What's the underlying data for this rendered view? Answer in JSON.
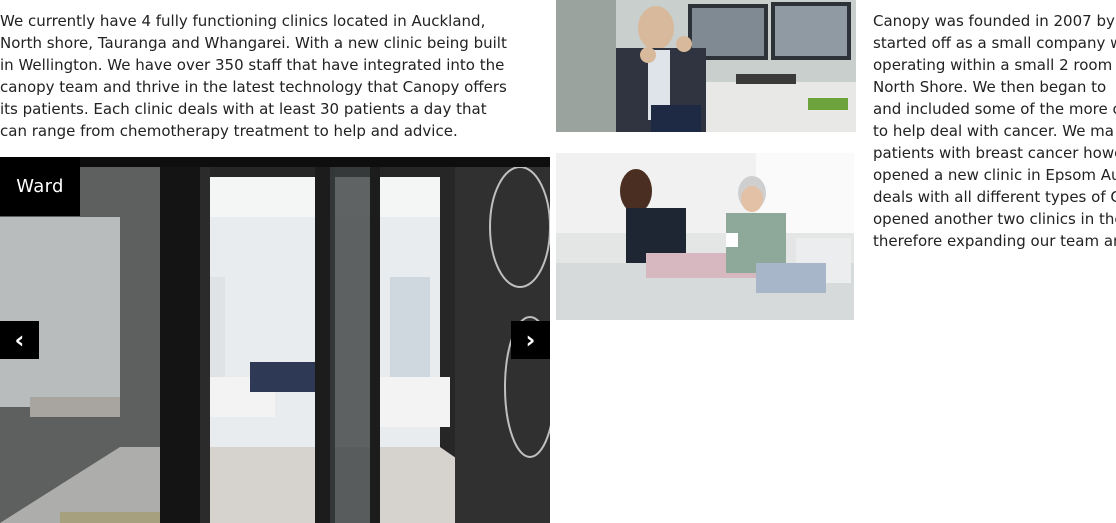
{
  "left_paragraph": {
    "lines": [
      "We currently have 4 fully functioning clinics located in Auckland,",
      "North shore, Tauranga and Whangarei. With a new clinic being built",
      "in Wellington. We have over 350 staff that have integrated into the",
      "canopy team and thrive in the latest technology that Canopy offers",
      "its patients. Each clinic deals with at least 30 patients a day that",
      "can range from chemotherapy treatment to help and advice."
    ]
  },
  "right_paragraph": {
    "lines": [
      "Canopy was founded in 2007 by",
      "started off as a small company w",
      "operating within a small 2 room",
      "North Shore. We then began to",
      "and included some of the more c",
      "to help deal with cancer. We ma",
      "patients with breast cancer howe",
      "opened a new clinic in Epsom Au",
      "deals with all different types of C",
      "opened another two clinics in the",
      "therefore expanding our team an"
    ]
  },
  "slideshow": {
    "caption": "Ward",
    "prev_icon": "‹",
    "next_icon": "›"
  },
  "colors": {
    "caption_bg": "#000000",
    "nav_bg": "#000000",
    "text": "#222222"
  }
}
